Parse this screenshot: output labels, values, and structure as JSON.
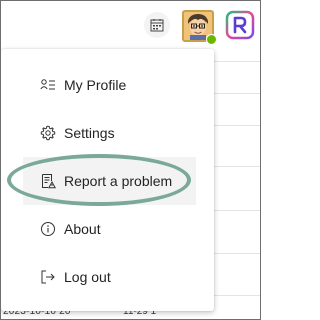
{
  "topbar": {
    "calendar_icon": "calendar-icon",
    "avatar_icon": "avatar-icon",
    "status_color": "#6bb700",
    "app_logo_icon": "app-logo-icon"
  },
  "menu": {
    "items": [
      {
        "label": "My Profile",
        "icon": "profile-card-icon"
      },
      {
        "label": "Settings",
        "icon": "gear-icon"
      },
      {
        "label": "Report a problem",
        "icon": "report-problem-icon"
      },
      {
        "label": "About",
        "icon": "info-icon"
      },
      {
        "label": "Log out",
        "icon": "sign-out-icon"
      }
    ]
  },
  "background": {
    "timestamp_fragment": "2023-10-10 20",
    "timestamp_fragment_2": "11-29 1"
  },
  "colors": {
    "highlight_ring": "#7aa89a",
    "menu_text": "#252423"
  }
}
